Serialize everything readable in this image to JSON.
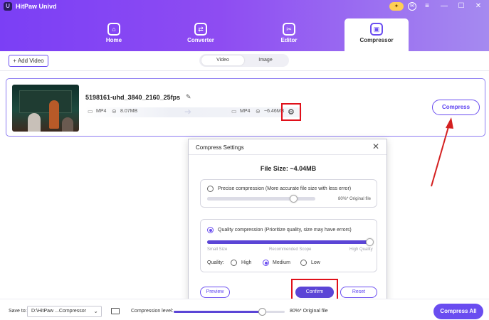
{
  "app": {
    "title": "HitPaw Univd",
    "logo_letter": "U"
  },
  "window_controls": {
    "badge": "✦",
    "mail": "✉",
    "menu": "≡",
    "minimize": "—",
    "maximize": "☐",
    "close": "✕"
  },
  "nav": {
    "tabs": [
      {
        "label": "Home",
        "icon": "home-icon",
        "glyph": "⌂"
      },
      {
        "label": "Converter",
        "icon": "converter-icon",
        "glyph": "⇄"
      },
      {
        "label": "Editor",
        "icon": "editor-icon",
        "glyph": "✂"
      },
      {
        "label": "Compressor",
        "icon": "compressor-icon",
        "glyph": "▣"
      }
    ],
    "active": "Compressor"
  },
  "toolbar": {
    "add_video": "+ Add Video",
    "segments": [
      "Video",
      "Image"
    ],
    "active_segment": "Video"
  },
  "file": {
    "name": "5198161-uhd_3840_2160_25fps",
    "source_format": "MP4",
    "source_size": "8.07MB",
    "target_format": "MP4",
    "target_size": "~6.46MB",
    "compress_label": "Compress"
  },
  "dialog": {
    "title": "Compress Settings",
    "file_size": "File Size:  ~4.04MB",
    "precise": {
      "label": "Precise compression (More accurate file size with less error)",
      "selected": false,
      "percent_text": "80%* Original file",
      "level": 0.8
    },
    "quality": {
      "label": "Quality compression (Prioritize quality, size may have errors)",
      "selected": true,
      "scale_labels": [
        "Small Size",
        "Recommended Scope",
        "High Quality"
      ],
      "level": 1.0,
      "row_label": "Quality:",
      "options": [
        {
          "label": "High",
          "selected": false
        },
        {
          "label": "Medium",
          "selected": true
        },
        {
          "label": "Low",
          "selected": false
        }
      ]
    },
    "buttons": {
      "preview": "Preview",
      "confirm": "Confirm",
      "reset": "Reset"
    }
  },
  "bottom": {
    "save_to_label": "Save to:",
    "save_path": "D:\\HitPaw ...Compressor",
    "compression_level_label": "Compression level:",
    "compression_level": 0.8,
    "compression_level_text": "80%* Original file",
    "compress_all": "Compress All"
  },
  "colors": {
    "accent": "#6a4df0",
    "highlight": "#e0101a"
  }
}
